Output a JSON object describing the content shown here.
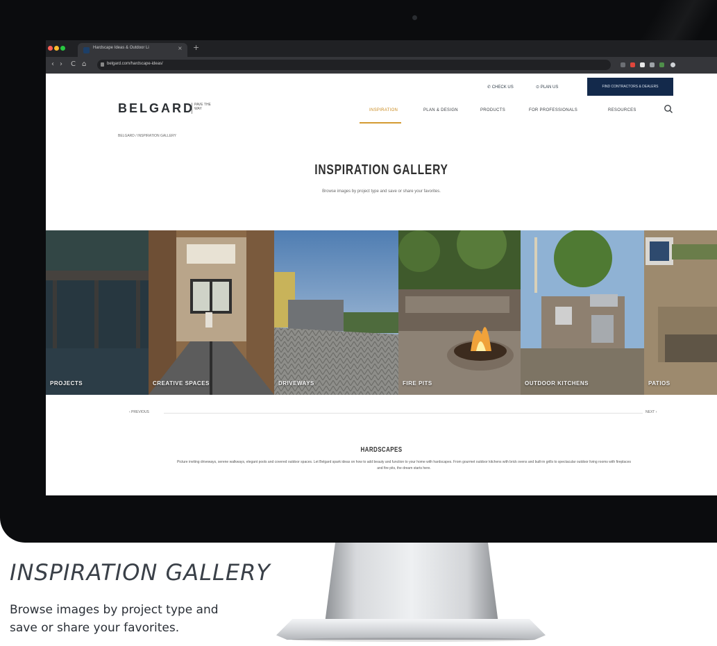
{
  "browser": {
    "tab_title": "Hardscape Ideas & Outdoor Li",
    "tab_close": "×",
    "new_tab": "+",
    "url": "belgard.com/hardscape-ideas/",
    "nav_back": "‹",
    "nav_forward": "›",
    "nav_reload": "C",
    "nav_home": "⌂",
    "traffic_lights": [
      "#ff5f57",
      "#febc2e",
      "#28c840"
    ],
    "extension_colors": [
      "#6c6f74",
      "#e0463c",
      "#e8e8e8",
      "#9fa3a8",
      "#4f8f4a",
      "#cfd2d6"
    ]
  },
  "site": {
    "utility": {
      "phone": "✆ CHECK US",
      "locate": "⊙ PLAN US",
      "cta": "FIND CONTRACTORS & DEALERS"
    },
    "logo": "BELGARD",
    "logo_tagline": "PAVE THE WAY",
    "nav": [
      {
        "label": "INSPIRATION",
        "active": true
      },
      {
        "label": "PLAN & DESIGN",
        "active": false
      },
      {
        "label": "PRODUCTS",
        "active": false
      },
      {
        "label": "FOR PROFESSIONALS",
        "active": false
      },
      {
        "label": "RESOURCES",
        "active": false
      }
    ],
    "breadcrumb": "BELGARD / INSPIRATION GALLERY",
    "title": "INSPIRATION GALLERY",
    "subtitle": "Browse images by project type and save or share your favorites.",
    "gallery": [
      {
        "label": "PROJECTS"
      },
      {
        "label": "CREATIVE SPACES"
      },
      {
        "label": "DRIVEWAYS"
      },
      {
        "label": "FIRE PITS"
      },
      {
        "label": "OUTDOOR KITCHENS"
      },
      {
        "label": "PATIOS"
      }
    ],
    "pager": {
      "previous": "‹ PREVIOUS",
      "next": "NEXT ›"
    },
    "section_title": "HARDSCAPES",
    "section_text": "Picture inviting driveways, serene walkways, elegant pools and covered outdoor spaces. Let Belgard spark ideas on how to add beauty and function to your home with hardscapes. From gourmet outdoor kitchens with brick ovens and built-in grills to spectacular outdoor living rooms with fireplaces and fire pits, the dream starts here."
  },
  "caption": {
    "title": "INSPIRATION GALLERY",
    "subtitle": "Browse images by project type and save or share your favorites."
  }
}
